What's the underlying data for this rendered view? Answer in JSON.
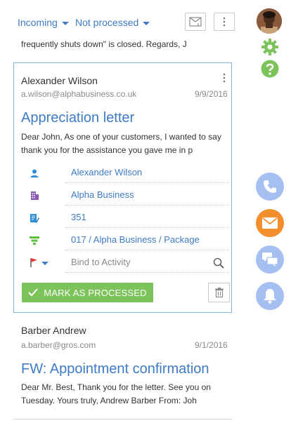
{
  "toolbar": {
    "filter_type": "Incoming",
    "filter_status": "Not processed"
  },
  "previous_snippet": "frequently shuts down\" is closed. Regards, J",
  "emails": [
    {
      "sender": "Alexander Wilson",
      "email": "a.wilson@alphabusiness.co.uk",
      "date": "9/9/2016",
      "subject": "Appreciation letter",
      "body_line1": "Dear John, As one of your customers, I wanted to say",
      "body_line2": "thank you for the assistance you gave me in p",
      "fields": {
        "contact": "Alexander Wilson",
        "account": "Alpha Business",
        "document": "351",
        "opportunity": "017 / Alpha Business / Package",
        "activity_placeholder": "Bind to Activity"
      },
      "mark_label": "MARK AS PROCESSED"
    },
    {
      "sender": "Barber Andrew",
      "email": "a.barber@gros.com",
      "date": "9/1/2016",
      "subject": "FW: Appointment confirmation",
      "body_line1": "Dear Mr. Best, Thank you for the letter. See you on",
      "body_line2": "Tuesday. Yours truly, Andrew Barber From: Joh"
    }
  ],
  "colors": {
    "accent_blue": "#3e7bc4",
    "green": "#7cc35c",
    "orange": "#f28f2c",
    "panel_blue": "#a5bff0"
  }
}
